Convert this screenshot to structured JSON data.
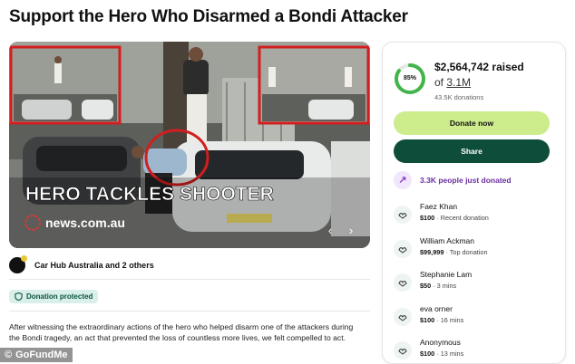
{
  "page": {
    "title": "Support the Hero Who Disarmed a Bondi Attacker"
  },
  "media": {
    "headline": "HERO TACKLES SHOOTER",
    "source_logo": "news.com.au",
    "prev_icon": "chevron-left-icon",
    "next_icon": "chevron-right-icon"
  },
  "organizer": {
    "text": "Car Hub Australia and 2 others"
  },
  "badge": {
    "label": "Donation protected"
  },
  "story": {
    "text": "After witnessing the extraordinary actions of the hero who helped disarm one of the attackers during the Bondi tragedy, an act that prevented the loss of countless more lives, we felt compelled to act."
  },
  "watermark": {
    "label": "GoFundMe"
  },
  "progress": {
    "percent_label": "85%",
    "percent": 0.85,
    "raised": "$2,564,742 raised",
    "of_word": "of",
    "goal": "3.1M",
    "donations": "43.5K donations"
  },
  "actions": {
    "donate_label": "Donate now",
    "share_label": "Share"
  },
  "trending": {
    "label": "3.3K people just donated"
  },
  "donors": [
    {
      "name": "Faez Khan",
      "amount": "$100",
      "meta": " · Recent donation"
    },
    {
      "name": "William Ackman",
      "amount": "$99,999",
      "meta": " · Top donation"
    },
    {
      "name": "Stephanie Lam",
      "amount": "$50",
      "meta": " · 3 mins"
    },
    {
      "name": "eva orner",
      "amount": "$100",
      "meta": " · 16 mins"
    },
    {
      "name": "Anonymous",
      "amount": "$100",
      "meta": " · 13 mins"
    }
  ],
  "colors": {
    "donate": "#cdec8c",
    "share": "#0e4d3a",
    "progress": "#42b54a",
    "frame": "#d21e1e"
  }
}
